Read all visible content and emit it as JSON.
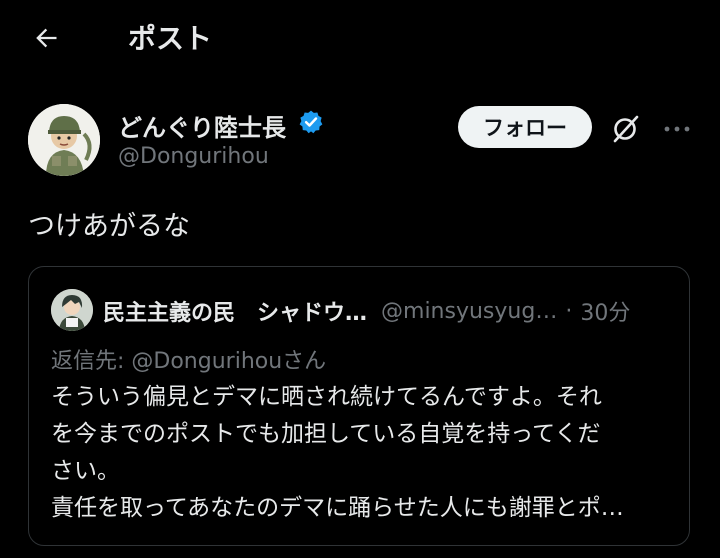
{
  "header": {
    "title": "ポスト",
    "back_icon": "arrow-left-icon"
  },
  "post": {
    "author_name": "どんぐり陸士長",
    "author_handle": "@Dongurihou",
    "verified_color": "#1d9bf0",
    "follow_label": "フォロー",
    "text": "つけあがるな"
  },
  "quote": {
    "name": "民主主義の民　シャドウ…",
    "handle": "@minsyusyug…",
    "separator": "·",
    "time": "30分",
    "reply_to": "返信先: @Dongurihouさん",
    "body_lines": [
      "そういう偏見とデマに晒され続けてるんですよ。それ",
      "を今までのポストでも加担している自覚を持ってくだ",
      "さい。",
      "責任を取ってあなたのデマに踊らせた人にも謝罪とポ…"
    ]
  }
}
